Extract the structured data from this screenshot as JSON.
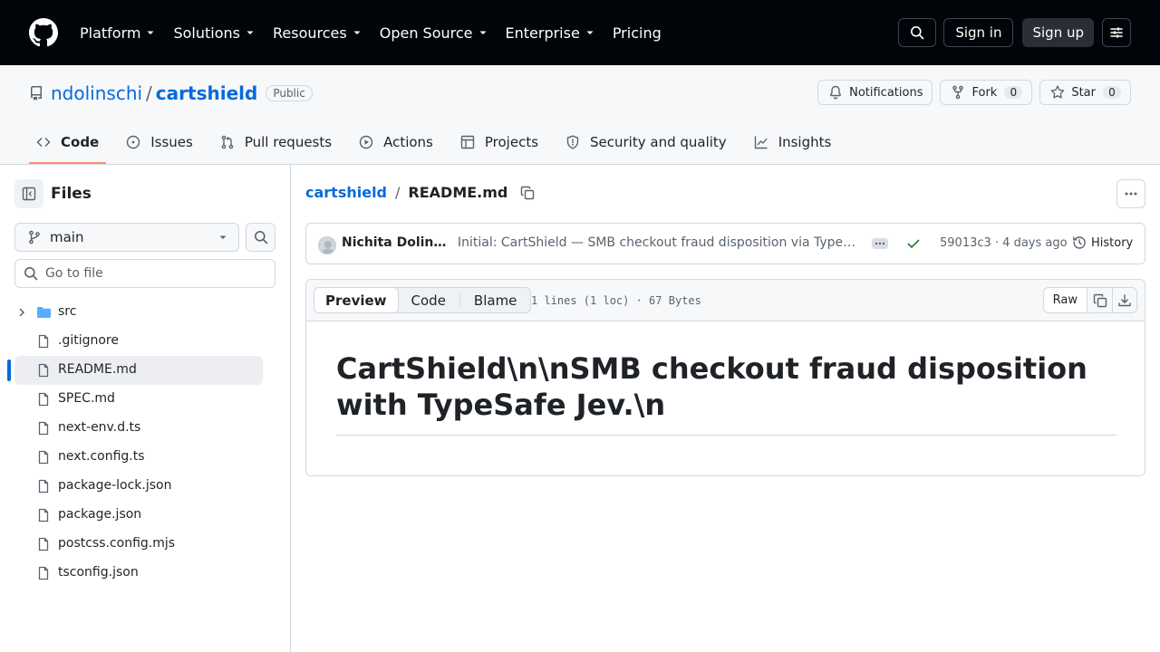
{
  "nav": {
    "items": [
      {
        "label": "Platform"
      },
      {
        "label": "Solutions"
      },
      {
        "label": "Resources"
      },
      {
        "label": "Open Source"
      },
      {
        "label": "Enterprise"
      },
      {
        "label": "Pricing"
      }
    ],
    "sign_in": "Sign in",
    "sign_up": "Sign up"
  },
  "repo": {
    "owner": "ndolinschi",
    "separator": "/",
    "name": "cartshield",
    "visibility": "Public",
    "notifications_label": "Notifications",
    "fork_label": "Fork",
    "fork_count": "0",
    "star_label": "Star",
    "star_count": "0"
  },
  "tabs": [
    {
      "label": "Code",
      "icon": "code-icon"
    },
    {
      "label": "Issues",
      "icon": "issue-icon"
    },
    {
      "label": "Pull requests",
      "icon": "pull-request-icon"
    },
    {
      "label": "Actions",
      "icon": "play-icon"
    },
    {
      "label": "Projects",
      "icon": "table-icon"
    },
    {
      "label": "Security and quality",
      "icon": "shield-icon"
    },
    {
      "label": "Insights",
      "icon": "graph-icon"
    }
  ],
  "sidebar": {
    "title": "Files",
    "branch": "main",
    "goto_placeholder": "Go to file",
    "tree": [
      {
        "label": "src",
        "type": "folder"
      },
      {
        "label": ".gitignore",
        "type": "file"
      },
      {
        "label": "README.md",
        "type": "file",
        "selected": true
      },
      {
        "label": "SPEC.md",
        "type": "file"
      },
      {
        "label": "next-env.d.ts",
        "type": "file"
      },
      {
        "label": "next.config.ts",
        "type": "file"
      },
      {
        "label": "package-lock.json",
        "type": "file"
      },
      {
        "label": "package.json",
        "type": "file"
      },
      {
        "label": "postcss.config.mjs",
        "type": "file"
      },
      {
        "label": "tsconfig.json",
        "type": "file"
      }
    ]
  },
  "breadcrumb": {
    "root": "cartshield",
    "separator": "/",
    "file": "README.md"
  },
  "commit": {
    "author": "Nichita Dolinschi",
    "message": "Initial: CartShield — SMB checkout fraud disposition via TypeSafe Jev",
    "sha_time": "59013c3 · 4 days ago",
    "history_label": "History"
  },
  "file": {
    "view_tabs": [
      "Preview",
      "Code",
      "Blame"
    ],
    "meta": "1 lines (1 loc) · 67 Bytes",
    "raw_label": "Raw",
    "readme_heading": "CartShield\\n\\nSMB checkout fraud disposition with TypeSafe Jev.\\n"
  },
  "colors": {
    "accent": "#0969da",
    "active_tab_underline": "#fd8c73",
    "success": "#1a7f37",
    "nav_bg": "#010409"
  }
}
